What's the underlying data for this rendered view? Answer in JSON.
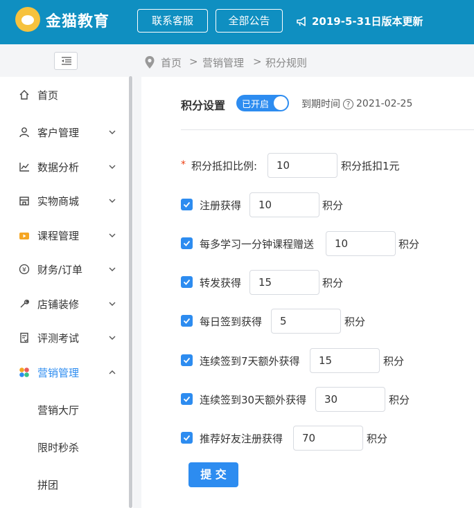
{
  "header": {
    "brand": "金猫教育",
    "btn_service": "联系客服",
    "btn_notice": "全部公告",
    "update_notice": "2019-5-31日版本更新"
  },
  "sidebar": {
    "items": [
      {
        "label": "首页",
        "icon": "home-icon"
      },
      {
        "label": "客户管理",
        "icon": "user-icon"
      },
      {
        "label": "数据分析",
        "icon": "chart-icon"
      },
      {
        "label": "实物商城",
        "icon": "store-icon"
      },
      {
        "label": "课程管理",
        "icon": "video-icon"
      },
      {
        "label": "财务/订单",
        "icon": "yen-icon"
      },
      {
        "label": "店铺装修",
        "icon": "wrench-icon"
      },
      {
        "label": "评测考试",
        "icon": "exam-icon"
      },
      {
        "label": "营销管理",
        "icon": "apps-icon"
      }
    ],
    "sub_items": [
      "营销大厅",
      "限时秒杀",
      "拼团"
    ]
  },
  "breadcrumb": {
    "home": "首页",
    "sep": ">",
    "level1": "营销管理",
    "level2": "积分规则"
  },
  "settings": {
    "title": "积分设置",
    "switch_label": "已开启",
    "expire_label": "到期时间",
    "expire_help": "?",
    "expire_date": "2021-02-25"
  },
  "form": {
    "ratio": {
      "label": "积分抵扣比例:",
      "value": "10",
      "unit": "积分抵扣1元"
    },
    "rows": [
      {
        "label": "注册获得",
        "value": "10",
        "unit": "积分"
      },
      {
        "label": "每多学习一分钟课程赠送",
        "value": "10",
        "unit": "积分"
      },
      {
        "label": "转发获得",
        "value": "15",
        "unit": "积分"
      },
      {
        "label": "每日签到获得",
        "value": "5",
        "unit": "积分"
      },
      {
        "label": "连续签到7天额外获得",
        "value": "15",
        "unit": "积分"
      },
      {
        "label": "连续签到30天额外获得",
        "value": "30",
        "unit": "积分"
      },
      {
        "label": "推荐好友注册获得",
        "value": "70",
        "unit": "积分"
      }
    ],
    "submit": "提 交"
  },
  "colors": {
    "header_bg": "#0f8fc1",
    "accent": "#2d8cf0",
    "required": "#ed4014"
  }
}
